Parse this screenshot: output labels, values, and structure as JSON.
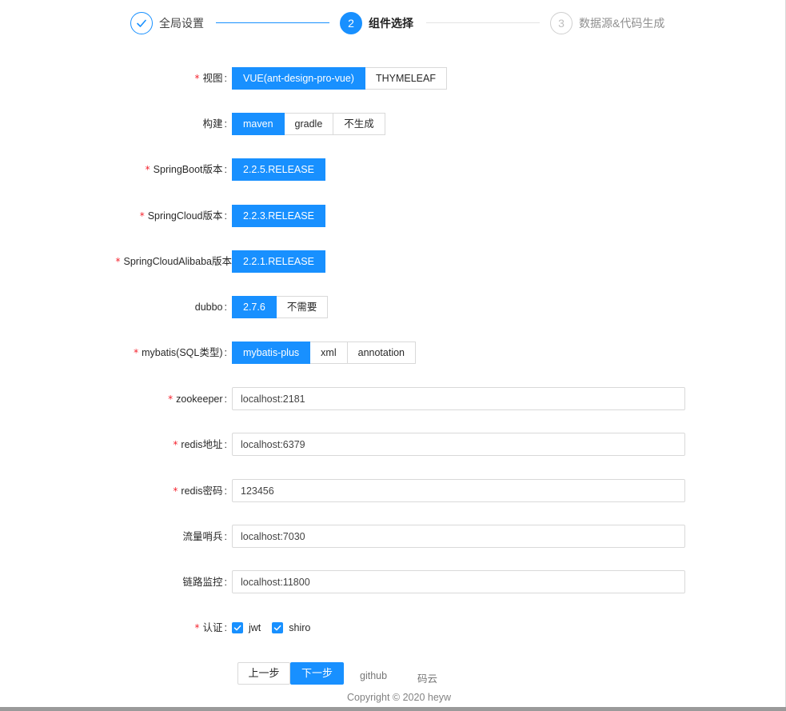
{
  "steps": [
    {
      "number": "1",
      "title": "全局设置",
      "status": "finished"
    },
    {
      "number": "2",
      "title": "组件选择",
      "status": "process"
    },
    {
      "number": "3",
      "title": "数据源&代码生成",
      "status": "wait"
    }
  ],
  "form": {
    "view": {
      "label": "视图",
      "required": true,
      "options": [
        "VUE(ant-design-pro-vue)",
        "THYMELEAF"
      ],
      "selected": "VUE(ant-design-pro-vue)"
    },
    "build": {
      "label": "构建",
      "required": false,
      "options": [
        "maven",
        "gradle",
        "不生成"
      ],
      "selected": "maven"
    },
    "springboot": {
      "label": "SpringBoot版本",
      "required": true,
      "options": [
        "2.2.5.RELEASE"
      ],
      "selected": "2.2.5.RELEASE"
    },
    "springcloud": {
      "label": "SpringCloud版本",
      "required": true,
      "options": [
        "2.2.3.RELEASE"
      ],
      "selected": "2.2.3.RELEASE"
    },
    "alibaba": {
      "label": "SpringCloudAlibaba版本",
      "required": true,
      "options": [
        "2.2.1.RELEASE"
      ],
      "selected": "2.2.1.RELEASE"
    },
    "dubbo": {
      "label": "dubbo",
      "required": false,
      "options": [
        "2.7.6",
        "不需要"
      ],
      "selected": "2.7.6"
    },
    "mybatis": {
      "label": "mybatis(SQL类型)",
      "required": true,
      "options": [
        "mybatis-plus",
        "xml",
        "annotation"
      ],
      "selected": "mybatis-plus"
    },
    "zookeeper": {
      "label": "zookeeper",
      "required": true,
      "value": "localhost:2181"
    },
    "redis_addr": {
      "label": "redis地址",
      "required": true,
      "value": "localhost:6379"
    },
    "redis_pwd": {
      "label": "redis密码",
      "required": true,
      "value": "123456"
    },
    "sentinel": {
      "label": "流量哨兵",
      "required": false,
      "value": "localhost:7030"
    },
    "tracing": {
      "label": "链路监控",
      "required": false,
      "value": "localhost:11800"
    },
    "auth": {
      "label": "认证",
      "required": true,
      "options": [
        {
          "label": "jwt",
          "checked": true
        },
        {
          "label": "shiro",
          "checked": true
        }
      ]
    }
  },
  "actions": {
    "prev": "上一步",
    "next": "下一步"
  },
  "footer": {
    "github": "github",
    "gitee": "码云",
    "copyright": "Copyright © 2020 heyw"
  },
  "colors": {
    "primary": "#1890ff",
    "required": "#f5222d",
    "border": "#d9d9d9"
  }
}
